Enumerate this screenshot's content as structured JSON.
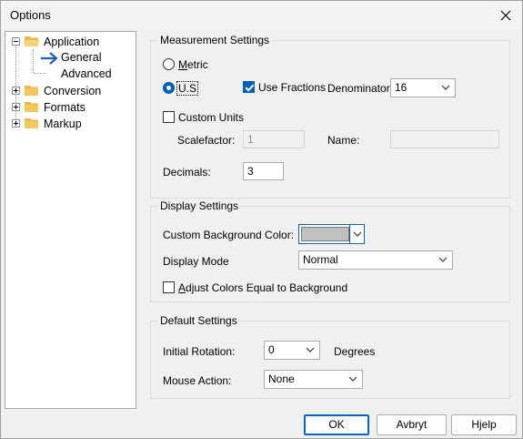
{
  "window": {
    "title": "Options"
  },
  "tree": {
    "application": "Application",
    "general": "General",
    "advanced": "Advanced",
    "conversion": "Conversion",
    "formats": "Formats",
    "markup": "Markup"
  },
  "measurement": {
    "title": "Measurement Settings",
    "metric_accel": "M",
    "metric_rest": "etric",
    "us_label": "U.S",
    "use_fractions": "Use Fractions",
    "denominator_label": "Denominator:",
    "denominator_value": "16",
    "custom_units": "Custom Units",
    "scalefactor_label": "Scalefactor:",
    "scalefactor_value": "1",
    "name_label": "Name:",
    "name_value": "",
    "decimals_label": "Decimals:",
    "decimals_value": "3"
  },
  "display": {
    "title": "Display Settings",
    "bg_color_label": "Custom Background Color:",
    "bg_color": "#c0c0c0",
    "mode_label": "Display Mode",
    "mode_value": "Normal",
    "adjust_accel": "A",
    "adjust_rest": "djust Colors Equal to Background"
  },
  "defaults": {
    "title": "Default Settings",
    "rotation_label": "Initial Rotation:",
    "rotation_value": "0",
    "degrees_label": "Degrees",
    "mouse_label": "Mouse Action:",
    "mouse_value": "None"
  },
  "buttons": {
    "ok": "OK",
    "cancel": "Avbryt",
    "help": "Hjelp"
  },
  "colors": {
    "accent": "#005fb8",
    "folder": "#e8b84a",
    "arrow": "#1f5fb0"
  }
}
